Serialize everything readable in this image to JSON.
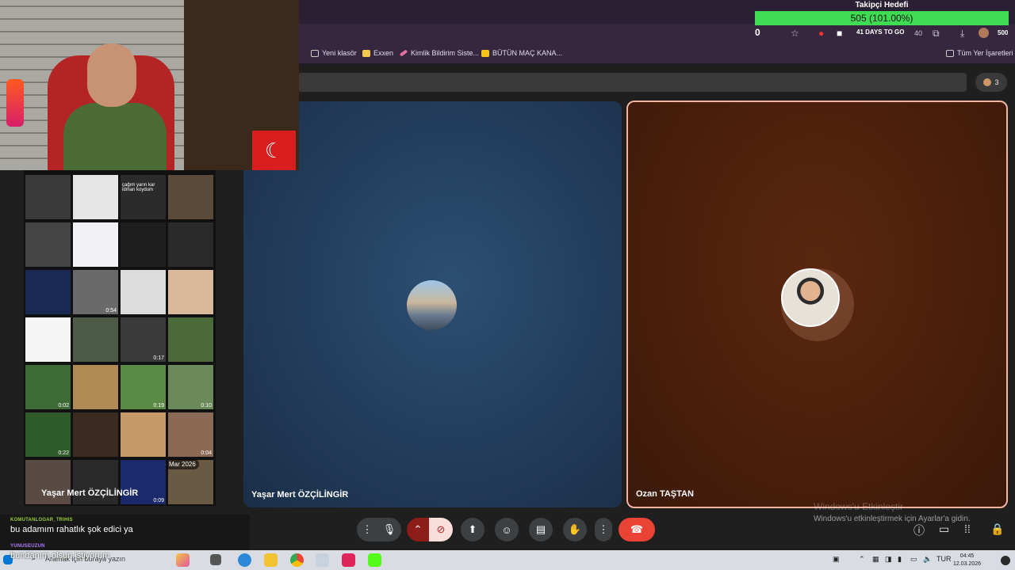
{
  "follower_goal": {
    "title": "Takipçi Hedefi",
    "value_text": "505 (101.00%)",
    "progress": 1.0
  },
  "toolbar": {
    "counter": "0",
    "days_badge": "41 DAYS TO GO",
    "ext_badge": "40",
    "side_count": "500"
  },
  "bookmarks": [
    {
      "label": "Yeni klasör",
      "icon": "folder-icon"
    },
    {
      "label": "Exxen",
      "icon": "exxen-icon"
    },
    {
      "label": "Kimlik Bildirim Siste...",
      "icon": "pen-icon"
    },
    {
      "label": "BÜTÜN MAÇ KANA...",
      "icon": "jp-icon"
    }
  ],
  "all_bookmarks": "Tüm Yer İşaretleri",
  "people_count": "3",
  "tiles": [
    {
      "name": "Yaşar Mert ÖZÇİLİNGİR"
    },
    {
      "name": "Ozan TAŞTAN"
    }
  ],
  "overlay_name": "Yaşar Mert ÖZÇİLİNGİR",
  "gallery": {
    "date_badge": "Mar 2026",
    "durations": [
      "0:54",
      "0:17",
      "0:02",
      "0:19",
      "0:10",
      "0:22",
      "0:04",
      "0:09"
    ],
    "text_snippet": "çağım yarın kar idman koydum"
  },
  "chat": [
    {
      "user": "KOMUTANLOGAR_TRIHIS",
      "message": "bu adamım rahatlık şok edici ya"
    },
    {
      "user": "YUNUSEUZUN",
      "message": "bundanım olsun istiyorum"
    }
  ],
  "watermark": {
    "line1": "Windows'u Etkinleştir",
    "line2": "Windows'u etkinleştirmek için Ayarlar'a gidin."
  },
  "taskbar": {
    "search_placeholder": "Aramak için buraya yazın",
    "lang": "TUR",
    "time": "04:45",
    "date": "12.03.2026"
  },
  "colors": {
    "goal_green": "#3ddc53",
    "speaking_border": "#f6b4a0",
    "end_call_red": "#ea4335"
  }
}
